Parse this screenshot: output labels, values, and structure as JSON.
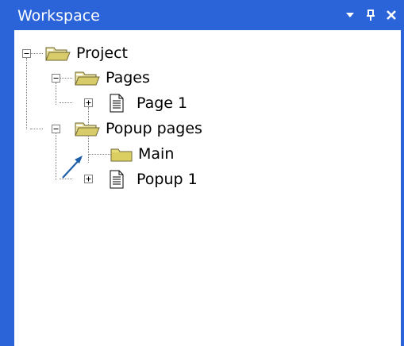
{
  "window": {
    "title": "Workspace",
    "buttons": {
      "dropdown": "▾",
      "pin": "Ұ",
      "close": "X"
    }
  },
  "tree": {
    "project": "Project",
    "pages": "Pages",
    "page1": "Page 1",
    "popup_pages": "Popup pages",
    "main": "Main",
    "popup1": "Popup 1"
  },
  "colors": {
    "titlebar": "#2b63d9",
    "arrow": "#1f5fa8"
  }
}
